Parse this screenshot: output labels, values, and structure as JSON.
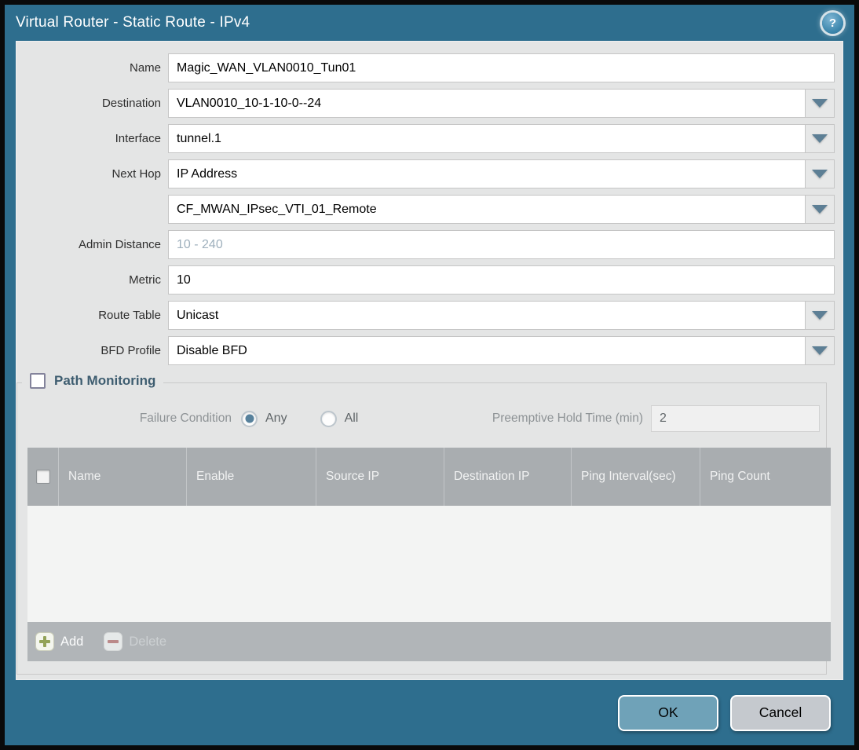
{
  "title_bar": {
    "title": "Virtual Router - Static Route - IPv4",
    "help_glyph": "?"
  },
  "form": {
    "rows": [
      {
        "label": "Name",
        "value": "Magic_WAN_VLAN0010_Tun01",
        "type": "text"
      },
      {
        "label": "Destination",
        "value": "VLAN0010_10-1-10-0--24",
        "type": "dropdown"
      },
      {
        "label": "Interface",
        "value": "tunnel.1",
        "type": "dropdown"
      },
      {
        "label": "Next Hop",
        "value": "IP Address",
        "type": "dropdown"
      },
      {
        "label": "",
        "value": "CF_MWAN_IPsec_VTI_01_Remote",
        "type": "dropdown"
      },
      {
        "label": "Admin Distance",
        "value": "",
        "placeholder": "10 - 240",
        "type": "text"
      },
      {
        "label": "Metric",
        "value": "10",
        "type": "text"
      },
      {
        "label": "Route Table",
        "value": "Unicast",
        "type": "dropdown"
      },
      {
        "label": "BFD Profile",
        "value": "Disable BFD",
        "type": "dropdown"
      }
    ]
  },
  "path_monitoring": {
    "title": "Path Monitoring",
    "checkbox_checked": false,
    "failure_condition_label": "Failure Condition",
    "options": [
      {
        "label": "Any",
        "selected": true
      },
      {
        "label": "All",
        "selected": false
      }
    ],
    "preemptive_label": "Preemptive Hold Time (min)",
    "preemptive_value": "2",
    "table": {
      "columns": [
        "Name",
        "Enable",
        "Source IP",
        "Destination IP",
        "Ping Interval(sec)",
        "Ping Count"
      ],
      "rows": []
    },
    "add_label": "Add",
    "delete_label": "Delete",
    "delete_enabled": false
  },
  "footer": {
    "ok_label": "OK",
    "cancel_label": "Cancel"
  },
  "colors": {
    "frame_teal": "#2e6e8e",
    "body_gray": "#e4e5e5",
    "table_header_gray": "#a9adb0",
    "ok_button_blue": "#6fa2b8",
    "cancel_button_gray": "#c5c9ce",
    "add_icon_green": "#93a359",
    "delete_icon_red": "#bb8a8a",
    "dropdown_arrow": "#5d7f95",
    "radio_selected": "#57819c"
  }
}
